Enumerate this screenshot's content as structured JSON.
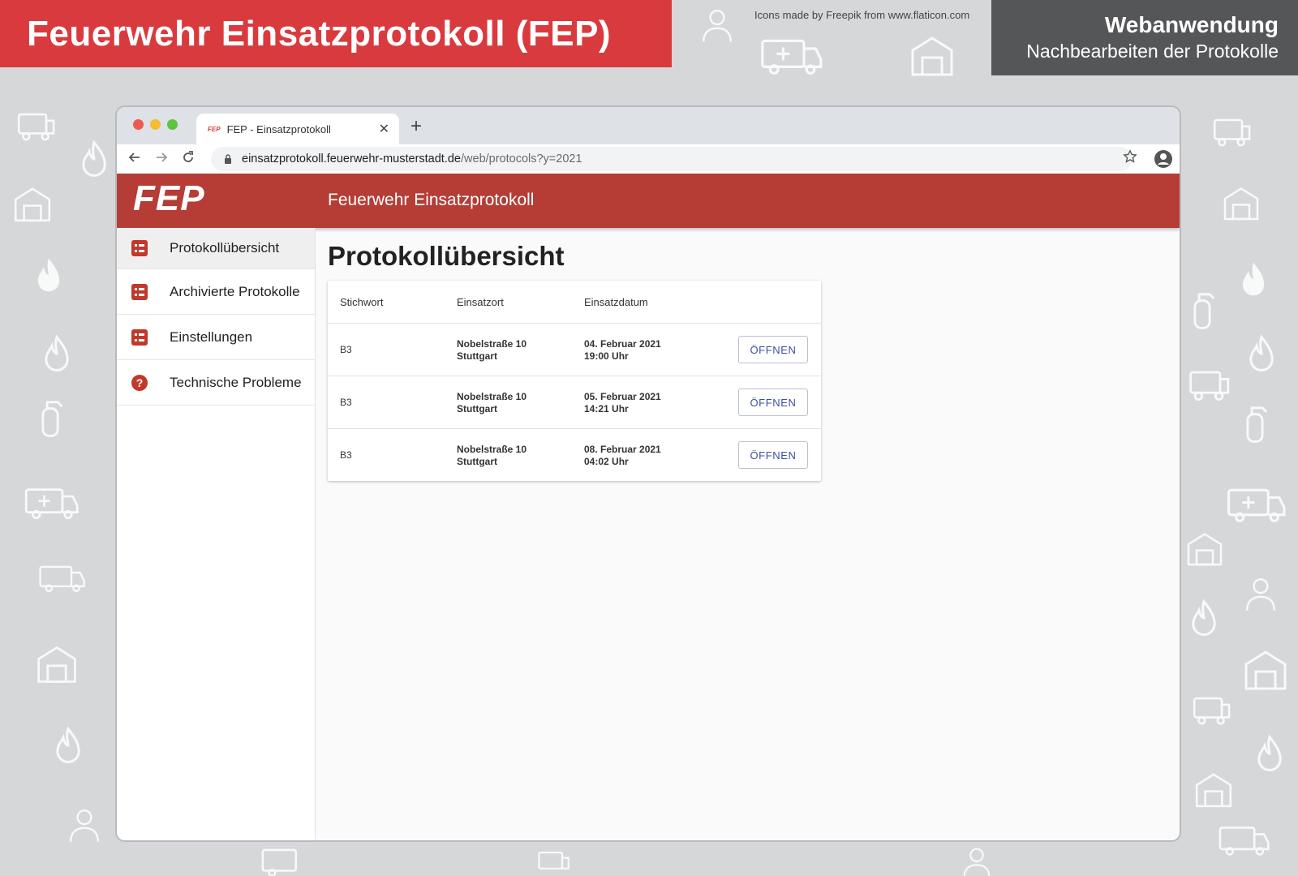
{
  "banner": {
    "title": "Feuerwehr Einsatzprotokoll (FEP)",
    "credit": "Icons made by Freepik from www.flaticon.com",
    "subtitle_line1": "Webanwendung",
    "subtitle_line2": "Nachbearbeiten der Protokolle"
  },
  "browser": {
    "tab_favicon": "FEP",
    "tab_title": "FEP - Einsatzprotokoll",
    "tab_close": "✕",
    "new_tab": "+",
    "url_host": "einsatzprotokoll.feuerwehr-musterstadt.de",
    "url_path": "/web/protocols?y=2021",
    "icons": [
      "back-arrow",
      "forward-arrow",
      "reload",
      "lock",
      "star",
      "profile"
    ]
  },
  "app": {
    "logo": "FEP",
    "title": "Feuerwehr Einsatzprotokoll",
    "brand_color": "#b53d36"
  },
  "sidebar": {
    "items": [
      {
        "label": "Protokollübersicht",
        "icon": "list-icon",
        "active": true
      },
      {
        "label": "Archivierte Protokolle",
        "icon": "list-icon",
        "active": false
      },
      {
        "label": "Einstellungen",
        "icon": "list-icon",
        "active": false
      },
      {
        "label": "Technische Probleme",
        "icon": "help-icon",
        "active": false
      }
    ]
  },
  "main": {
    "page_title": "Protokollübersicht",
    "table": {
      "headers": [
        "Stichwort",
        "Einsatzort",
        "Einsatzdatum"
      ],
      "rows": [
        {
          "stichwort": "B3",
          "ort_line1": "Nobelstraße 10",
          "ort_line2": "Stuttgart",
          "datum_line1": "04. Februar 2021",
          "datum_line2": "19:00 Uhr",
          "action": "ÖFFNEN"
        },
        {
          "stichwort": "B3",
          "ort_line1": "Nobelstraße 10",
          "ort_line2": "Stuttgart",
          "datum_line1": "05. Februar 2021",
          "datum_line2": "14:21 Uhr",
          "action": "ÖFFNEN"
        },
        {
          "stichwort": "B3",
          "ort_line1": "Nobelstraße 10",
          "ort_line2": "Stuttgart",
          "datum_line1": "08. Februar 2021",
          "datum_line2": "04:02 Uhr",
          "action": "ÖFFNEN"
        }
      ]
    }
  }
}
